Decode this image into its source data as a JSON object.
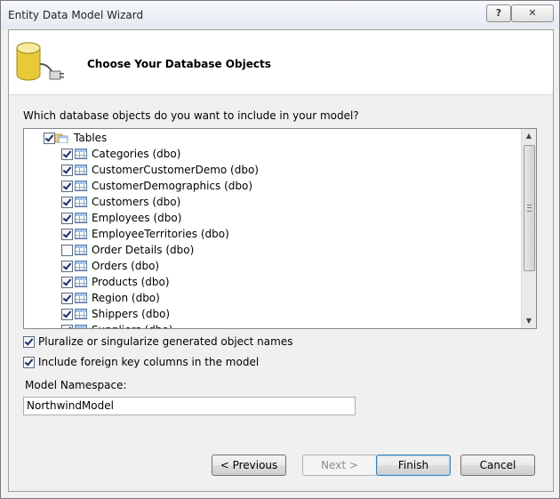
{
  "window": {
    "title": "Entity Data Model Wizard",
    "help_label": "?",
    "close_label": "✕"
  },
  "header": {
    "title": "Choose Your Database Objects",
    "icon": "database-plug-icon"
  },
  "question": "Which database objects do you want to include in your model?",
  "tree": {
    "root": {
      "label": "Tables",
      "checked": true,
      "icon": "tables-folder-icon"
    },
    "items": [
      {
        "label": "Categories (dbo)",
        "checked": true
      },
      {
        "label": "CustomerCustomerDemo (dbo)",
        "checked": true
      },
      {
        "label": "CustomerDemographics (dbo)",
        "checked": true
      },
      {
        "label": "Customers (dbo)",
        "checked": true
      },
      {
        "label": "Employees (dbo)",
        "checked": true
      },
      {
        "label": "EmployeeTerritories (dbo)",
        "checked": true
      },
      {
        "label": "Order Details (dbo)",
        "checked": false
      },
      {
        "label": "Orders (dbo)",
        "checked": true
      },
      {
        "label": "Products (dbo)",
        "checked": true
      },
      {
        "label": "Region (dbo)",
        "checked": true
      },
      {
        "label": "Shippers (dbo)",
        "checked": true
      },
      {
        "label": "Suppliers (dbo)",
        "checked": true
      }
    ]
  },
  "options": {
    "pluralize": {
      "label": "Pluralize or singularize generated object names",
      "checked": true
    },
    "foreign_keys": {
      "label": "Include foreign key columns in the model",
      "checked": true
    }
  },
  "namespace": {
    "label": "Model Namespace:",
    "value": "NorthwindModel"
  },
  "buttons": {
    "previous": "< Previous",
    "next": "Next >",
    "finish": "Finish",
    "cancel": "Cancel"
  },
  "colors": {
    "accent": "#3c7fb1",
    "check": "#1b2e66"
  }
}
